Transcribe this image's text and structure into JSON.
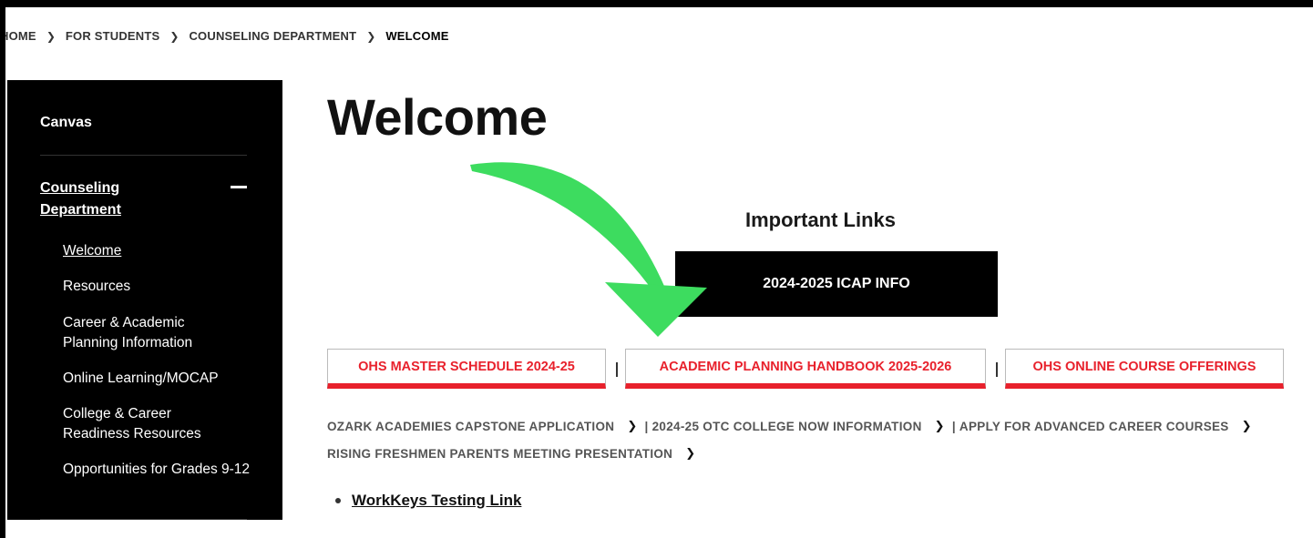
{
  "breadcrumb": {
    "items": [
      "HOME",
      "FOR STUDENTS",
      "COUNSELING DEPARTMENT",
      "WELCOME"
    ],
    "separator": ">"
  },
  "sidebar": {
    "canvas": "Canvas",
    "department": "Counseling Department",
    "collapse_symbol": "minus",
    "items": [
      {
        "label": "Welcome"
      },
      {
        "label": "Resources"
      },
      {
        "label": "Career & Academic Planning Information"
      },
      {
        "label": "Online Learning/MOCAP"
      },
      {
        "label": "College & Career Readiness Resources"
      },
      {
        "label": "Opportunities for Grades 9-12"
      }
    ]
  },
  "main": {
    "title": "Welcome",
    "important_heading": "Important Links",
    "icap_button": "2024-2025 ICAP INFO",
    "buttons": [
      {
        "label": "OHS MASTER SCHEDULE 2024-25"
      },
      {
        "label": "ACADEMIC PLANNING HANDBOOK 2025-2026"
      },
      {
        "label": "OHS ONLINE COURSE OFFERINGS"
      }
    ],
    "text_links": [
      {
        "label": "OZARK ACADEMIES CAPSTONE APPLICATION"
      },
      {
        "label": "2024-25 OTC COLLEGE NOW INFORMATION"
      },
      {
        "label": "APPLY FOR ADVANCED CAREER COURSES"
      },
      {
        "label": "RISING FRESHMEN PARENTS MEETING PRESENTATION"
      }
    ],
    "bullet_link": "WorkKeys Testing Link"
  },
  "colors": {
    "accent_red": "#e8212c",
    "arrow_green": "#3ddc5f",
    "sidebar_bg": "#000000"
  }
}
